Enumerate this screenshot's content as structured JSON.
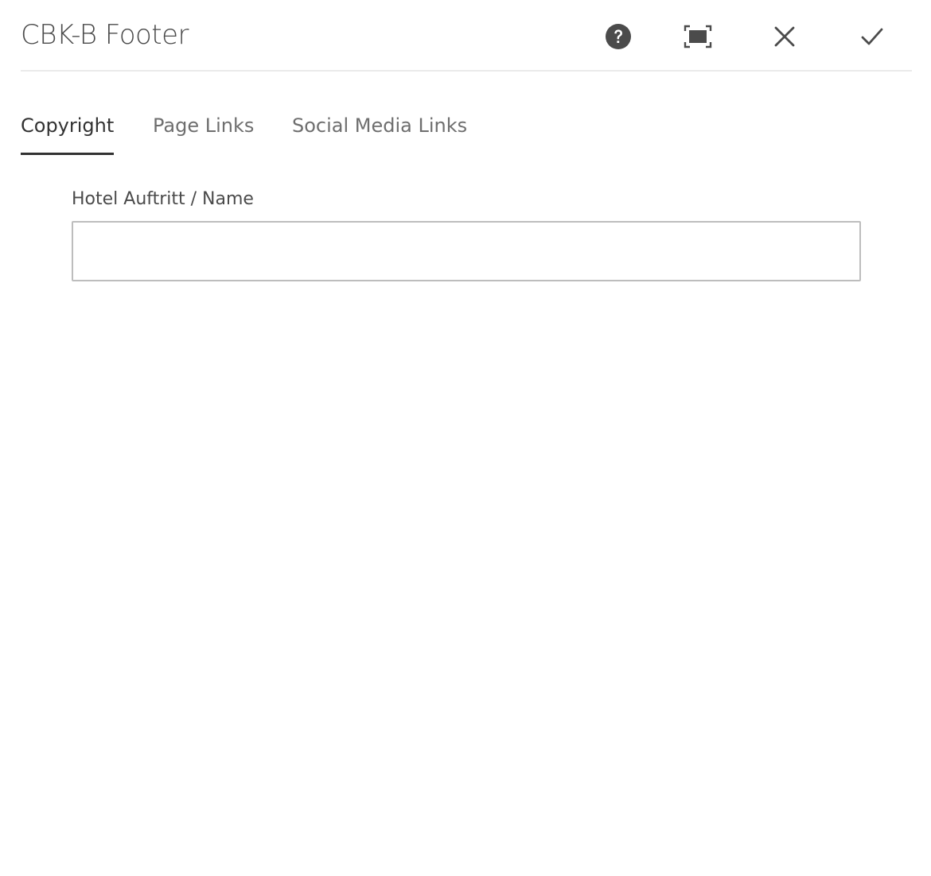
{
  "dialog": {
    "title": "CBK-B Footer",
    "actions": {
      "help_icon": "help-circle-icon",
      "fullscreen_icon": "fullscreen-icon",
      "close_icon": "close-icon",
      "done_icon": "checkmark-icon"
    }
  },
  "tabs": [
    {
      "label": "Copyright",
      "active": true
    },
    {
      "label": "Page Links",
      "active": false
    },
    {
      "label": "Social Media Links",
      "active": false
    }
  ],
  "form": {
    "hotel_name": {
      "label": "Hotel Auftritt / Name",
      "value": "",
      "placeholder": ""
    }
  },
  "colors": {
    "text": "#4b4b4b",
    "active_tab": "#323232",
    "divider": "#eaeaea",
    "input_border": "#bdbdbd"
  }
}
